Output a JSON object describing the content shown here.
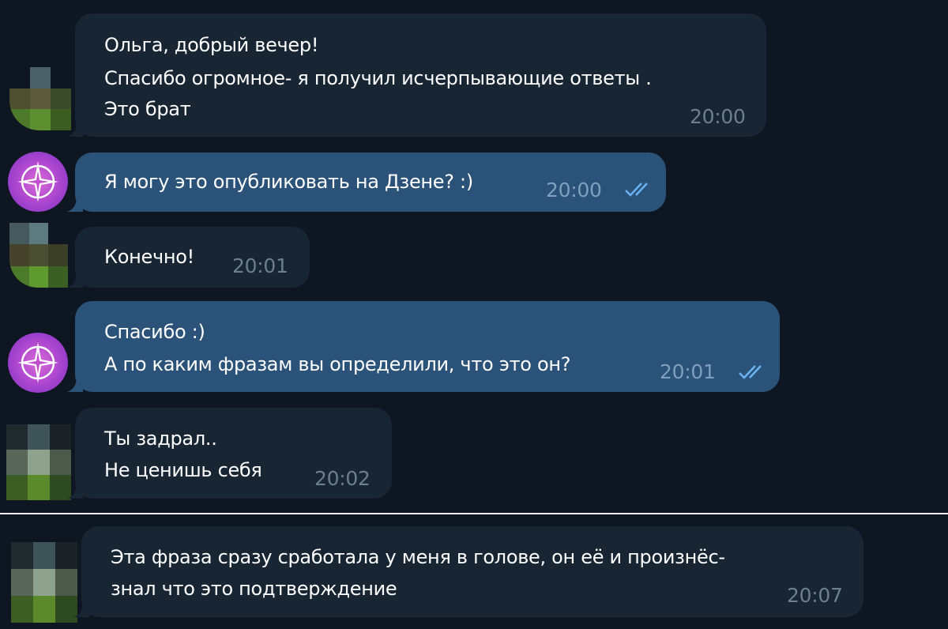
{
  "messages": [
    {
      "id": 1,
      "direction": "in",
      "lines": [
        "Ольга, добрый вечер!",
        "Спасибо огромное- я получил исчерпывающие ответы .",
        "Это брат"
      ],
      "time": "20:00"
    },
    {
      "id": 2,
      "direction": "out",
      "lines": [
        "Я могу это опубликовать на Дзене? :)"
      ],
      "time": "20:00",
      "status_icon": "double-check-icon"
    },
    {
      "id": 3,
      "direction": "in",
      "lines": [
        "Конечно!"
      ],
      "time": "20:01"
    },
    {
      "id": 4,
      "direction": "out",
      "lines": [
        "Спасибо :)",
        "А по каким фразам вы определили, что это он?"
      ],
      "time": "20:01",
      "status_icon": "double-check-icon"
    },
    {
      "id": 5,
      "direction": "in",
      "lines": [
        "Ты задрал..",
        "Не ценишь себя"
      ],
      "time": "20:02"
    },
    {
      "id": 6,
      "direction": "in",
      "lines": [
        "Эта фраза сразу сработала у меня в голове, он её и произнёс-",
        "знал что это подтверждение"
      ],
      "time": "20:07"
    }
  ],
  "colors": {
    "background": "#0e1621",
    "incoming_bubble": "#182533",
    "outgoing_bubble": "#2b5278",
    "time_incoming": "#6d7f8f",
    "time_outgoing": "#7ea0bf",
    "check_color": "#6ab3f3",
    "avatar_gradient": "#b24ad0"
  }
}
